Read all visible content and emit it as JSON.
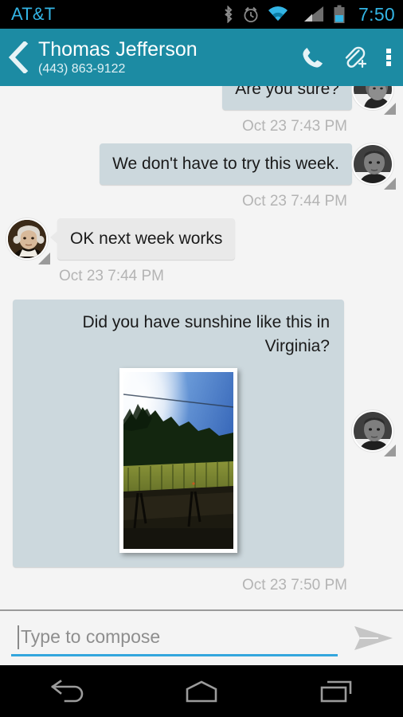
{
  "status_bar": {
    "carrier": "AT&T",
    "clock": "7:50",
    "accent_color": "#33b5e5",
    "background": "#000000",
    "icons": [
      "bluetooth-icon",
      "alarm-icon",
      "wifi-icon",
      "signal-icon",
      "battery-icon"
    ]
  },
  "app_bar": {
    "background": "#1c8ba3",
    "back_icon": "back-chevron-icon",
    "contact_name": "Thomas Jefferson",
    "contact_number": "(443) 863-9122",
    "actions": [
      {
        "name": "call-button",
        "icon": "phone-icon"
      },
      {
        "name": "attach-button",
        "icon": "paperclip-plus-icon"
      },
      {
        "name": "overflow-button",
        "icon": "overflow-menu-icon"
      }
    ]
  },
  "thread": {
    "bubble_color_incoming": "#e9e9e9",
    "bubble_color_outgoing": "#ccd8dd",
    "messages": [
      {
        "id": "msg-are-you-sure",
        "direction": "outgoing",
        "text": "Are you sure?",
        "timestamp": "Oct 23 7:43 PM",
        "avatar": "avatar-self",
        "clipped": true
      },
      {
        "id": "msg-dont-have-to-try",
        "direction": "outgoing",
        "text": "We don't have to try this week.",
        "timestamp": "Oct 23 7:44 PM",
        "avatar": "avatar-self"
      },
      {
        "id": "msg-ok-next-week",
        "direction": "incoming",
        "text": "OK next week works",
        "timestamp": "Oct 23 7:44 PM",
        "avatar": "avatar-thomas-jefferson"
      },
      {
        "id": "msg-sunshine-mms",
        "direction": "outgoing",
        "text": "Did you have sunshine like this in Virginia?",
        "timestamp": "Oct 23 7:50 PM",
        "avatar": "avatar-self",
        "attachment": "photo-vineyard-sunshine"
      }
    ]
  },
  "compose": {
    "placeholder": "Type to compose",
    "value": "",
    "underline_color": "#33a6dd",
    "send_icon": "send-arrow-icon"
  },
  "nav_bar": {
    "buttons": [
      {
        "name": "nav-back-button",
        "icon": "nav-back-icon"
      },
      {
        "name": "nav-home-button",
        "icon": "nav-home-icon"
      },
      {
        "name": "nav-recents-button",
        "icon": "nav-recents-icon"
      }
    ]
  }
}
